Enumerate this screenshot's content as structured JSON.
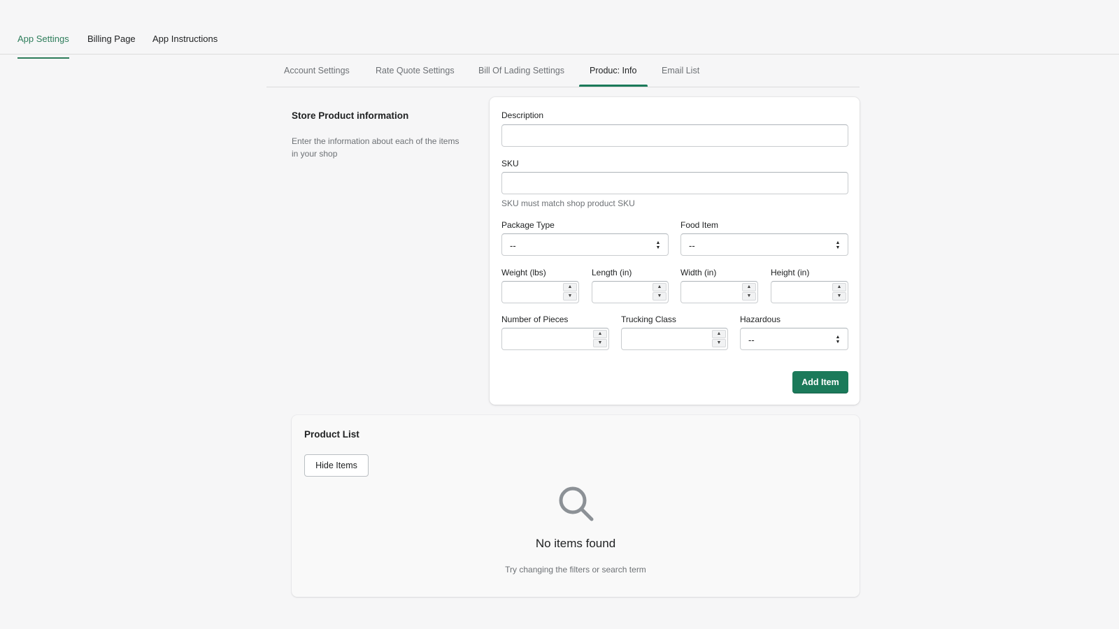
{
  "topnav": {
    "tabs": [
      {
        "label": "App Settings",
        "active": true
      },
      {
        "label": "Billing Page",
        "active": false
      },
      {
        "label": "App Instructions",
        "active": false
      }
    ]
  },
  "subtabs": [
    {
      "label": "Account Settings",
      "active": false
    },
    {
      "label": "Rate Quote Settings",
      "active": false
    },
    {
      "label": "Bill Of Lading Settings",
      "active": false
    },
    {
      "label": "Produc: Info",
      "active": true
    },
    {
      "label": "Email List",
      "active": false
    }
  ],
  "section": {
    "title": "Store Product information",
    "description": "Enter the information about each of the items in your shop"
  },
  "form": {
    "description_label": "Description",
    "description_value": "",
    "sku_label": "SKU",
    "sku_value": "",
    "sku_help": "SKU must match shop product SKU",
    "package_type_label": "Package Type",
    "package_type_value": "--",
    "food_item_label": "Food Item",
    "food_item_value": "--",
    "weight_label": "Weight (lbs)",
    "length_label": "Length (in)",
    "width_label": "Width (in)",
    "height_label": "Height (in)",
    "pieces_label": "Number of Pieces",
    "trucking_class_label": "Trucking Class",
    "hazardous_label": "Hazardous",
    "hazardous_value": "--",
    "add_button": "Add Item"
  },
  "product_list": {
    "title": "Product List",
    "hide_button": "Hide Items",
    "empty_title": "No items found",
    "empty_subtitle": "Try changing the filters or search term"
  },
  "colors": {
    "accent": "#1b7a5a",
    "tab_active": "#2e7d5b",
    "background": "#f6f6f7"
  },
  "icons": {
    "empty_state": "search-icon",
    "select": "chevron-up-down-icon",
    "stepper": "stepper-arrows-icon"
  }
}
